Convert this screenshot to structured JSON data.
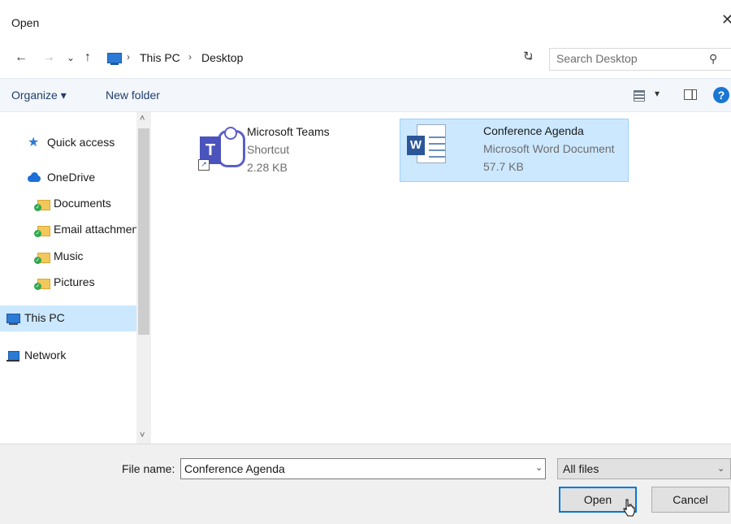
{
  "window": {
    "title": "Open",
    "close_glyph": "✕"
  },
  "address": {
    "back": "←",
    "forward": "→",
    "recent": "⌄",
    "up": "↑",
    "breadcrumb": [
      "This PC",
      "Desktop"
    ],
    "separator": "›",
    "dropdown": "⌄",
    "refresh": "↻",
    "search_placeholder": "Search Desktop"
  },
  "toolbar": {
    "organize_label": "Organize ▾",
    "new_folder_label": "New folder",
    "view_dd": "▾",
    "help": "?"
  },
  "nav": {
    "items": [
      {
        "label": "Quick access",
        "icon": "star-icon"
      },
      {
        "label": "OneDrive",
        "icon": "cloud-icon"
      },
      {
        "label": "Documents",
        "icon": "folder-icon"
      },
      {
        "label": "Email attachments",
        "icon": "folder-icon"
      },
      {
        "label": "Music",
        "icon": "folder-icon"
      },
      {
        "label": "Pictures",
        "icon": "folder-icon"
      },
      {
        "label": "This PC",
        "icon": "computer-icon",
        "selected": true
      },
      {
        "label": "Network",
        "icon": "network-icon"
      }
    ],
    "scroll_up": "˄",
    "scroll_down": "˅"
  },
  "files": [
    {
      "name": "Microsoft Teams",
      "type": "Shortcut",
      "size": "2.28 KB",
      "icon": "teams-icon",
      "icon_letter": "T",
      "shortcut_glyph": "↗"
    },
    {
      "name": "Conference Agenda",
      "type": "Microsoft Word Document",
      "size": "57.7 KB",
      "icon": "word-icon",
      "icon_letter": "W",
      "selected": true
    }
  ],
  "bottom": {
    "file_name_label": "File name:",
    "file_name_value": "Conference Agenda",
    "file_name_dd": "⌄",
    "file_type": "All files",
    "file_type_dd": "⌄",
    "open_label": "Open",
    "cancel_label": "Cancel"
  },
  "colors": {
    "selection": "#cce8ff",
    "accent": "#0078d7",
    "teams": "#4b53bc",
    "word": "#2b579a"
  }
}
